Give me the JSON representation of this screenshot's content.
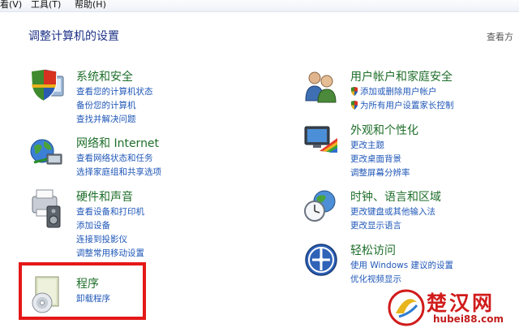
{
  "menubar": {
    "items": [
      {
        "label": "看(V)"
      },
      {
        "label": "工具(T)"
      },
      {
        "label": "帮助(H)"
      }
    ]
  },
  "header": {
    "title": "调整计算机的设置",
    "view_by": "查看方"
  },
  "categories": {
    "system": {
      "title": "系统和安全",
      "links": [
        "查看您的计算机状态",
        "备份您的计算机",
        "查找并解决问题"
      ]
    },
    "network": {
      "title": "网络和 Internet",
      "links": [
        "查看网络状态和任务",
        "选择家庭组和共享选项"
      ]
    },
    "hardware": {
      "title": "硬件和声音",
      "links": [
        "查看设备和打印机",
        "添加设备",
        "连接到投影仪",
        "调整常用移动设置"
      ]
    },
    "programs": {
      "title": "程序",
      "links": [
        "卸载程序"
      ]
    },
    "users": {
      "title": "用户帐户和家庭安全",
      "links": [
        "添加或删除用户帐户",
        "为所有用户设置家长控制"
      ]
    },
    "appearance": {
      "title": "外观和个性化",
      "links": [
        "更改主题",
        "更改桌面背景",
        "调整屏幕分辨率"
      ]
    },
    "clock": {
      "title": "时钟、语言和区域",
      "links": [
        "更改键盘或其他输入法",
        "更改显示语言"
      ]
    },
    "ease": {
      "title": "轻松访问",
      "links": [
        "使用 Windows 建议的设置",
        "优化视频显示"
      ]
    }
  },
  "watermark": {
    "brand": "楚汉网",
    "domain": "hubei88.com"
  },
  "colors": {
    "title_green": "#1e6e2a",
    "link_blue": "#1f57b8",
    "header_blue": "#1e3287",
    "highlight_red": "#e41818"
  }
}
